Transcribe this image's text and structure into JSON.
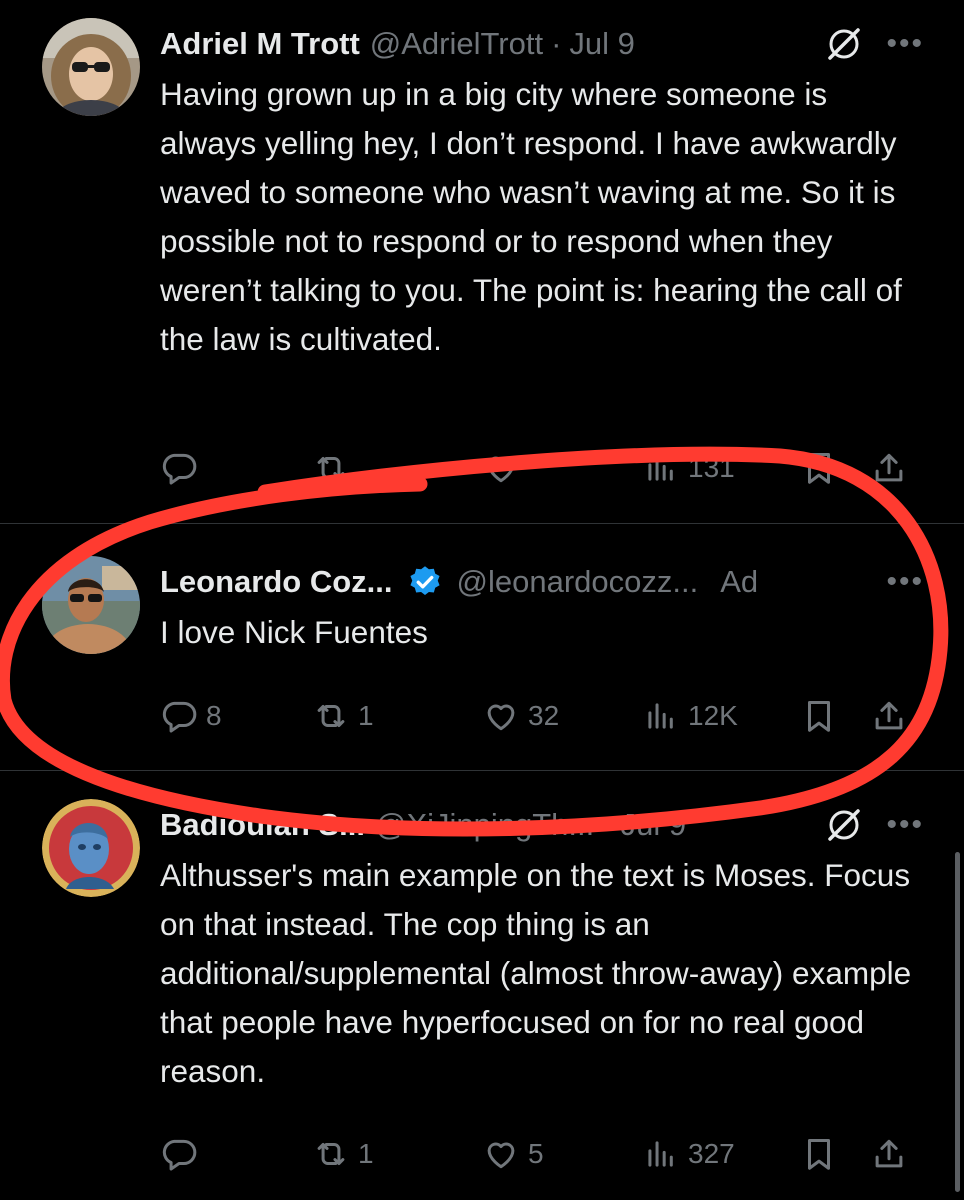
{
  "tweets": [
    {
      "name": "Adriel M Trott",
      "handle": "@AdrielTrott",
      "separator": "·",
      "date": "Jul 9",
      "more": "•••",
      "text": "Having grown up in a big city where someone is always yelling hey, I don’t respond. I have awkwardly waved to someone who wasn’t waving at me. So it is possible not to respond or to respond when they weren’t talking to you. The point is: hearing the call of the law is cultivated.",
      "views": "131"
    },
    {
      "name": "Leonardo Coz...",
      "handle": "@leonardocozz...",
      "ad_label": "Ad",
      "more": "•••",
      "text": "I love Nick Fuentes",
      "replies": "8",
      "reposts": "1",
      "likes": "32",
      "views": "12K"
    },
    {
      "name": "Badiouian S...",
      "handle": "@XiJinpingTh...",
      "separator": "·",
      "date": "Jul 9",
      "more": "•••",
      "text": "Althusser's main example on the text is Moses. Focus on that instead. The cop thing is an additional/supplemental (almost throw-away) example that people have hyperfocused on for no real good reason.",
      "replies": "",
      "reposts": "1",
      "likes": "5",
      "views": "327"
    }
  ],
  "colors": {
    "background": "#000000",
    "text": "#e7e9ea",
    "muted": "#71767b",
    "divider": "#2f3336",
    "verified": "#1d9bf0",
    "annotation": "#ff3b30"
  },
  "icons": [
    "reply-icon",
    "repost-icon",
    "like-icon",
    "views-icon",
    "bookmark-icon",
    "share-icon",
    "grok-icon",
    "more-icon",
    "verified-badge-icon"
  ]
}
